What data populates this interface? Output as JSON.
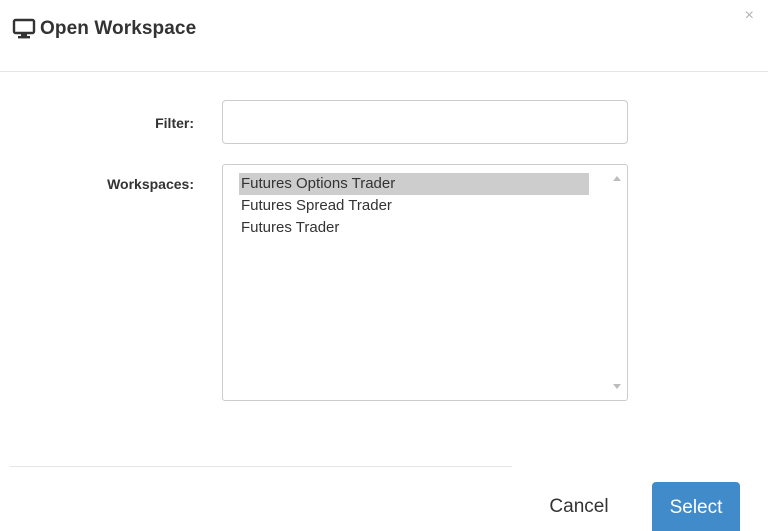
{
  "dialog": {
    "title": "Open Workspace",
    "title_icon": "monitor-icon",
    "close_symbol": "×"
  },
  "form": {
    "filter_label": "Filter:",
    "filter_value": "",
    "filter_placeholder": "",
    "workspaces_label": "Workspaces:",
    "workspaces": [
      {
        "label": "Futures Options Trader",
        "selected": true
      },
      {
        "label": "Futures Spread Trader",
        "selected": false
      },
      {
        "label": "Futures Trader",
        "selected": false
      }
    ]
  },
  "footer": {
    "cancel_label": "Cancel",
    "select_label": "Select"
  },
  "colors": {
    "primary_button": "#428bca",
    "selected_item": "#cdcdcd",
    "close_icon": "#b3b3b3"
  }
}
